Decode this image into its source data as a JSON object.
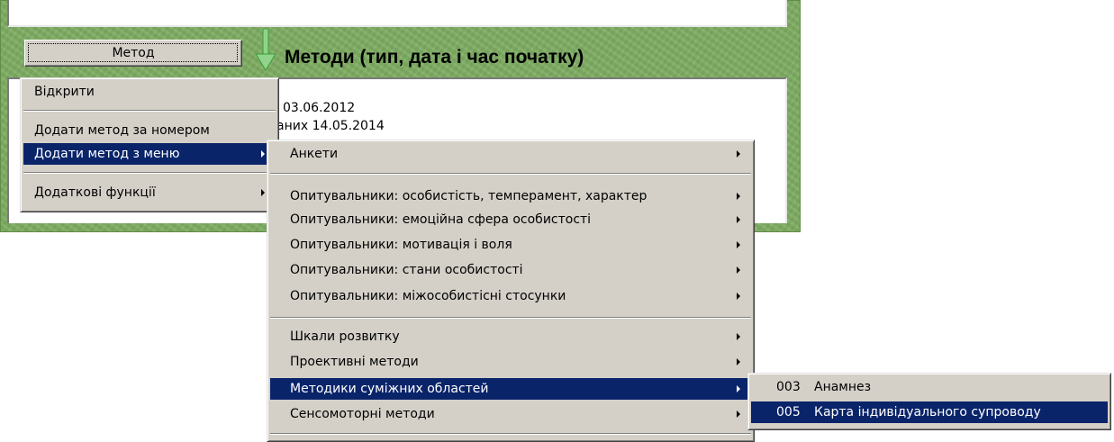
{
  "method_button": {
    "label": "Метод"
  },
  "methods_heading": "Методи (тип, дата і час початку)",
  "list": {
    "line1": "03.06.2012",
    "line2": "аних  14.05.2014"
  },
  "context_menu": {
    "items": [
      {
        "label": "Відкрити",
        "has_submenu": false
      },
      {
        "label": "Додати метод за номером",
        "has_submenu": false
      },
      {
        "label": "Додати метод з меню",
        "has_submenu": true,
        "selected": true
      },
      {
        "label": "Додаткові функції",
        "has_submenu": true
      }
    ]
  },
  "submenu": {
    "items": [
      {
        "label": "Анкети"
      },
      {
        "label": "Опитувальники: особистість, темперамент, характер"
      },
      {
        "label": "Опитувальники: емоційна сфера особистості"
      },
      {
        "label": "Опитувальники: мотивація і воля"
      },
      {
        "label": "Опитувальники: стани особистості"
      },
      {
        "label": "Опитувальники: міжособистісні стосунки"
      },
      {
        "label": "Шкали розвитку"
      },
      {
        "label": "Проективні методи"
      },
      {
        "label": "Методики суміжних областей",
        "selected": true
      },
      {
        "label": "Сенсомоторні методи"
      }
    ]
  },
  "submenu2": {
    "items": [
      {
        "code": "003",
        "label": "Анамнез"
      },
      {
        "code": "005",
        "label": "Карта індивідуального супроводу",
        "selected": true
      }
    ]
  },
  "colors": {
    "panel_green": "#7fae63",
    "menu_face": "#d4d0c8",
    "highlight": "#0a246a",
    "arrow_green": "#3cb043"
  },
  "icons": {
    "down_arrow": "green-down-arrow-icon",
    "submenu_arrow": "chevron-right-icon"
  }
}
